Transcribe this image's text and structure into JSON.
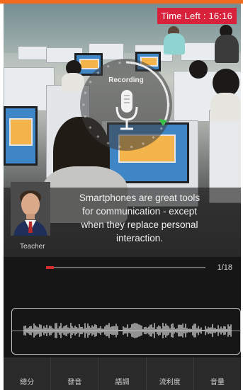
{
  "status": {
    "time_left": "Time Left : 16:16"
  },
  "recorder": {
    "label": "Recording"
  },
  "teacher": {
    "label": "Teacher"
  },
  "caption": {
    "lines": [
      "Smartphones are great tools",
      "for communication - except",
      "when they replace personal",
      "interaction."
    ]
  },
  "progress": {
    "value": 0.05,
    "counter": "1/18"
  },
  "tabs": [
    {
      "label": "總分"
    },
    {
      "label": "發音"
    },
    {
      "label": "語調"
    },
    {
      "label": "流利度"
    },
    {
      "label": "音量"
    }
  ],
  "colors": {
    "accent_top": "#f26a1b",
    "time_badge": "#d8223c",
    "progress": "#d52b2b"
  }
}
